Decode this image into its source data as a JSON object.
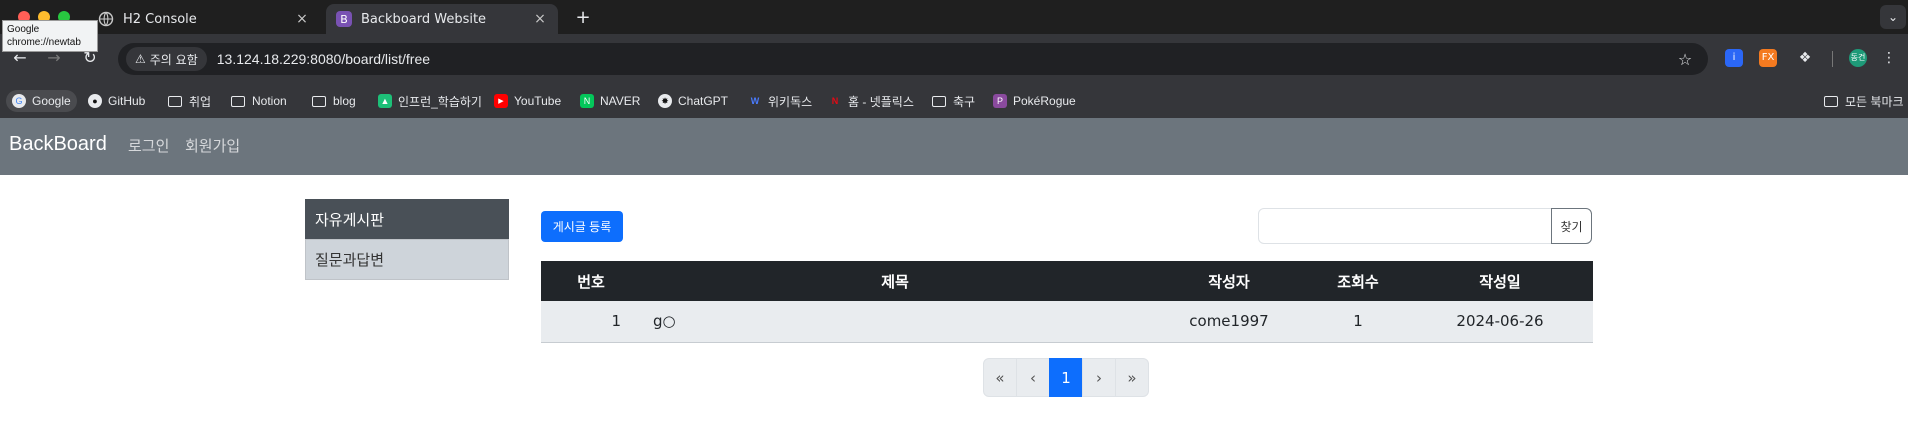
{
  "browser": {
    "tooltip": {
      "line1": "Google",
      "line2": "chrome://newtab"
    },
    "tabs": [
      {
        "title": "H2 Console",
        "close": "×"
      },
      {
        "title": "Backboard Website",
        "close": "×",
        "icon_text": "B"
      }
    ],
    "new_tab": "+",
    "tab_menu": "⌄",
    "security_label": "주의 요함",
    "url": "13.124.18.229:8080/board/list/free",
    "bookmarks": [
      {
        "label": "Google",
        "icon": "google-icon"
      },
      {
        "label": "GitHub",
        "icon": "github-icon"
      },
      {
        "label": "취업",
        "icon": "folder-icon"
      },
      {
        "label": "Notion",
        "icon": "folder-icon"
      },
      {
        "label": "blog",
        "icon": "folder-icon"
      },
      {
        "label": "인프런_학습하기",
        "icon": "inflearn-icon"
      },
      {
        "label": "YouTube",
        "icon": "youtube-icon"
      },
      {
        "label": "NAVER",
        "icon": "naver-icon"
      },
      {
        "label": "ChatGPT",
        "icon": "chatgpt-icon"
      },
      {
        "label": "위키독스",
        "icon": "wikidocs-icon"
      },
      {
        "label": "홈 - 넷플릭스",
        "icon": "netflix-icon"
      },
      {
        "label": "축구",
        "icon": "folder-icon"
      },
      {
        "label": "PokéRogue",
        "icon": "pokerogue-icon"
      }
    ],
    "all_bookmarks": "모든 북마크",
    "profile_text": "동건"
  },
  "site": {
    "brand": "BackBoard",
    "nav": {
      "login": "로그인",
      "signup": "회원가입"
    },
    "sidebar": [
      {
        "label": "자유게시판",
        "active": true
      },
      {
        "label": "질문과답변",
        "active": false
      }
    ],
    "write_button": "게시글 등록",
    "search": {
      "value": "",
      "button": "찾기"
    },
    "table": {
      "headers": {
        "no": "번호",
        "title": "제목",
        "writer": "작성자",
        "views": "조회수",
        "date": "작성일"
      },
      "rows": [
        {
          "no": "1",
          "title": "g○",
          "writer": "come1997",
          "views": "1",
          "date": "2024-06-26"
        }
      ]
    },
    "pagination": {
      "first": "«",
      "prev": "‹",
      "current": "1",
      "next": "›",
      "last": "»"
    }
  }
}
